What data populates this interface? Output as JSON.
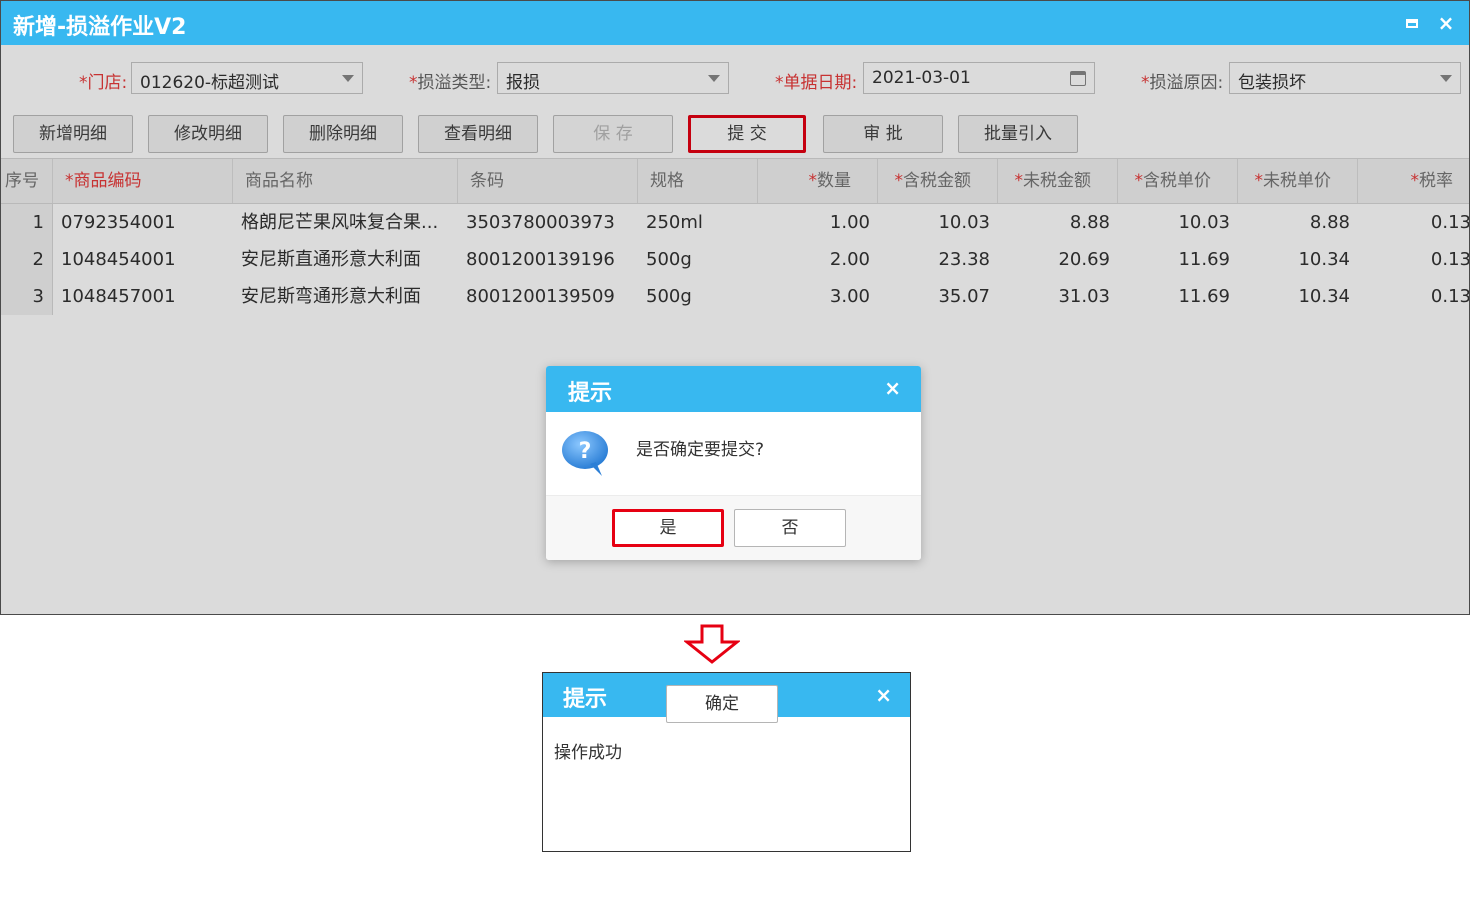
{
  "window": {
    "title": "新增-损溢作业V2",
    "max_icon": "maximize-icon",
    "close_glyph": "×"
  },
  "form": {
    "store": {
      "req": "*",
      "label": "门店:",
      "value": "012620-标超测试"
    },
    "type": {
      "req": "*",
      "label": "损溢类型:",
      "value": "报损"
    },
    "date": {
      "req": "*",
      "label": "单据日期:",
      "value": "2021-03-01"
    },
    "reason": {
      "req": "*",
      "label": "损溢原因:",
      "value": "包装损坏"
    }
  },
  "toolbar": {
    "add_detail": "新增明细",
    "edit_detail": "修改明细",
    "delete_detail": "删除明细",
    "view_detail": "查看明细",
    "save": "保 存",
    "submit": "提 交",
    "approve": "审 批",
    "batch_import": "批量引入"
  },
  "grid": {
    "headers": {
      "seq": "序号",
      "code": "*商品编码",
      "name": "商品名称",
      "barcode": "条码",
      "spec": "规格",
      "qty_star": "*",
      "qty": "数量",
      "amt_tax_star": "*",
      "amt_tax": "含税金额",
      "amt_notax_star": "*",
      "amt_notax": "未税金额",
      "price_tax_star": "*",
      "price_tax": "含税单价",
      "price_notax_star": "*",
      "price_notax": "未税单价",
      "rate_star": "*",
      "rate": "税率"
    },
    "rows": [
      {
        "seq": "1",
        "code": "0792354001",
        "name": "格朗尼芒果风味复合果...",
        "barcode": "3503780003973",
        "spec": "250ml",
        "qty": "1.00",
        "amt_tax": "10.03",
        "amt_notax": "8.88",
        "price_tax": "10.03",
        "price_notax": "8.88",
        "rate": "0.13"
      },
      {
        "seq": "2",
        "code": "1048454001",
        "name": "安尼斯直通形意大利面",
        "barcode": "8001200139196",
        "spec": "500g",
        "qty": "2.00",
        "amt_tax": "23.38",
        "amt_notax": "20.69",
        "price_tax": "11.69",
        "price_notax": "10.34",
        "rate": "0.13"
      },
      {
        "seq": "3",
        "code": "1048457001",
        "name": "安尼斯弯通形意大利面",
        "barcode": "8001200139509",
        "spec": "500g",
        "qty": "3.00",
        "amt_tax": "35.07",
        "amt_notax": "31.03",
        "price_tax": "11.69",
        "price_notax": "10.34",
        "rate": "0.13"
      }
    ]
  },
  "confirm_dialog": {
    "title": "提示",
    "close_glyph": "×",
    "icon": "question-icon",
    "message": "是否确定要提交?",
    "yes": "是",
    "no": "否"
  },
  "result_dialog": {
    "title": "提示",
    "close_glyph": "×",
    "message": "操作成功",
    "ok": "确定"
  },
  "colors": {
    "title_bar": "#38b8f0",
    "highlight": "#e60012",
    "required": "#e83b3b"
  }
}
